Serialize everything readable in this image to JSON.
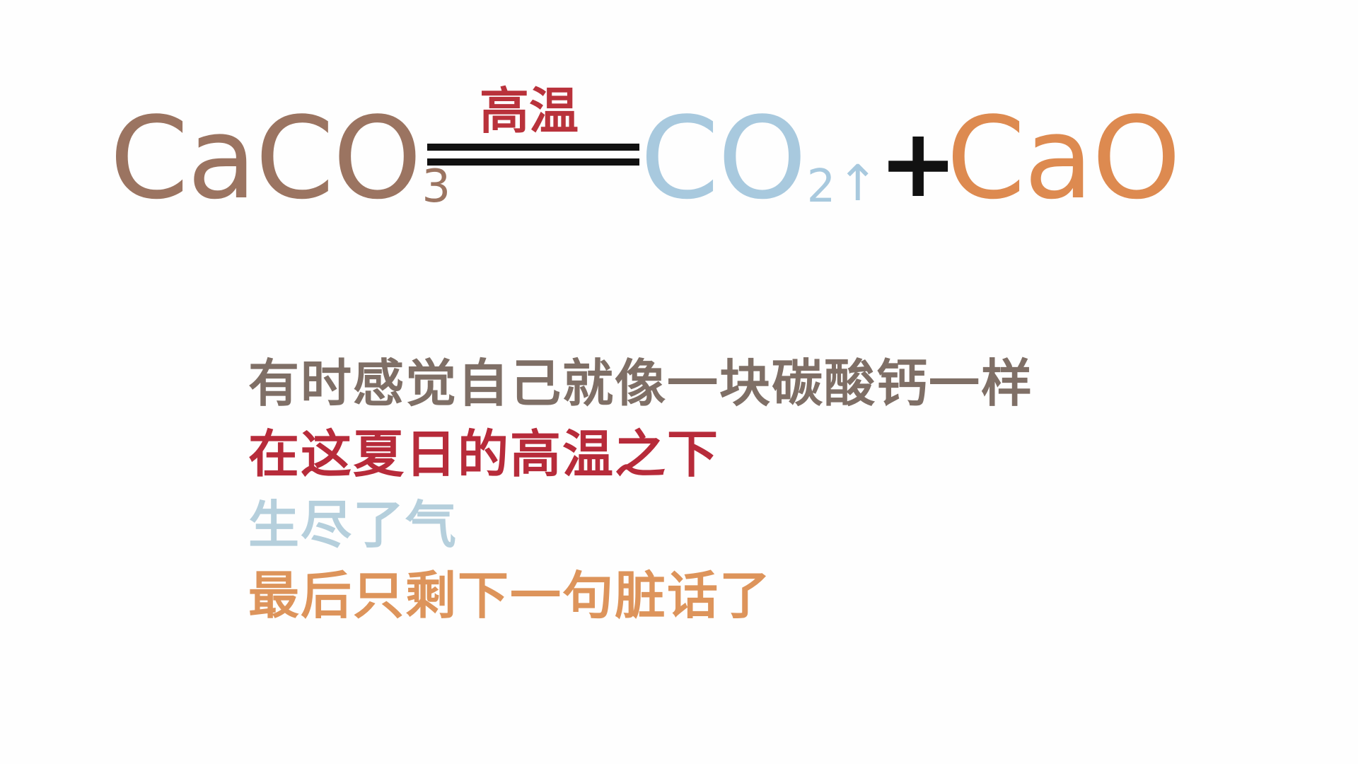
{
  "equation": {
    "reactant": {
      "main": "CaCO",
      "subscript": "3",
      "color": "#9b7461"
    },
    "condition": {
      "text": "高温",
      "color": "#b9323b"
    },
    "equals_color": "#111111",
    "product_gas": {
      "main": "CO",
      "subscript": "2",
      "arrow": "↑",
      "color": "#a8c9de"
    },
    "plus": {
      "text": "+",
      "color": "#111111"
    },
    "product_solid": {
      "main": "CaO",
      "color": "#dd8a50"
    }
  },
  "poem": {
    "lines": [
      {
        "text": "有时感觉自己就像一块碳酸钙一样",
        "color": "#7f6f66"
      },
      {
        "text": "在这夏日的高温之下",
        "color": "#b72b3a"
      },
      {
        "text": "生尽了气",
        "color": "#b5cfdc"
      },
      {
        "text": "最后只剩下一句脏话了",
        "color": "#dd945b"
      }
    ]
  }
}
